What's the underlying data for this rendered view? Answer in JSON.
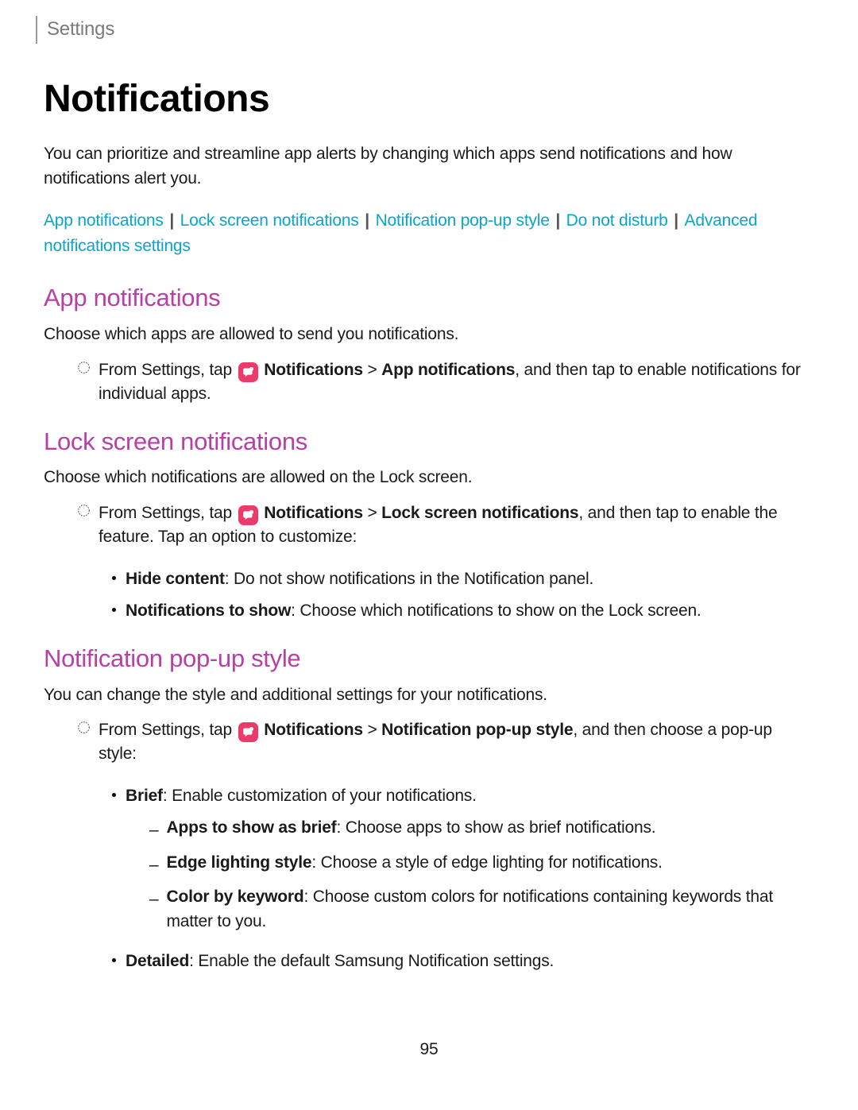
{
  "breadcrumb": "Settings",
  "title": "Notifications",
  "intro": "You can prioritize and streamline app alerts by changing which apps send notifications and how notifications alert you.",
  "nav": {
    "link1": "App notifications",
    "link2": "Lock screen notifications",
    "link3": "Notification pop-up style",
    "link4": "Do not disturb",
    "link5": "Advanced notifications settings"
  },
  "s1": {
    "heading": "App notifications",
    "desc": "Choose which apps are allowed to send you notifications.",
    "step": {
      "pre": "From Settings, tap ",
      "bold1": "Notifications",
      "gt": " > ",
      "bold2": "App notifications",
      "post": ", and then tap to enable notifications for individual apps."
    }
  },
  "s2": {
    "heading": "Lock screen notifications",
    "desc": "Choose which notifications are allowed on the Lock screen.",
    "step": {
      "pre": "From Settings, tap ",
      "bold1": "Notifications",
      "gt": " > ",
      "bold2": "Lock screen notifications",
      "post": ", and then tap to enable the feature. Tap an option to customize:"
    },
    "b1": {
      "title": "Hide content",
      "desc": ": Do not show notifications in the Notification panel."
    },
    "b2": {
      "title": "Notifications to show",
      "desc": ": Choose which notifications to show on the Lock screen."
    }
  },
  "s3": {
    "heading": "Notification pop-up style",
    "desc": "You can change the style and additional settings for your notifications.",
    "step": {
      "pre": "From Settings, tap ",
      "bold1": "Notifications",
      "gt": " > ",
      "bold2": "Notification pop-up style",
      "post": ", and then choose a pop-up style:"
    },
    "b1": {
      "title": "Brief",
      "desc": ": Enable customization of your notifications."
    },
    "sub1": {
      "title": "Apps to show as brief",
      "desc": ": Choose apps to show as brief notifications."
    },
    "sub2": {
      "title": "Edge lighting style",
      "desc": ": Choose a style of edge lighting for notifications."
    },
    "sub3": {
      "title": "Color by keyword",
      "desc": ": Choose custom colors for notifications containing keywords that matter to you."
    },
    "b2": {
      "title": "Detailed",
      "desc": ": Enable the default Samsung Notification settings."
    }
  },
  "pageNumber": "95"
}
